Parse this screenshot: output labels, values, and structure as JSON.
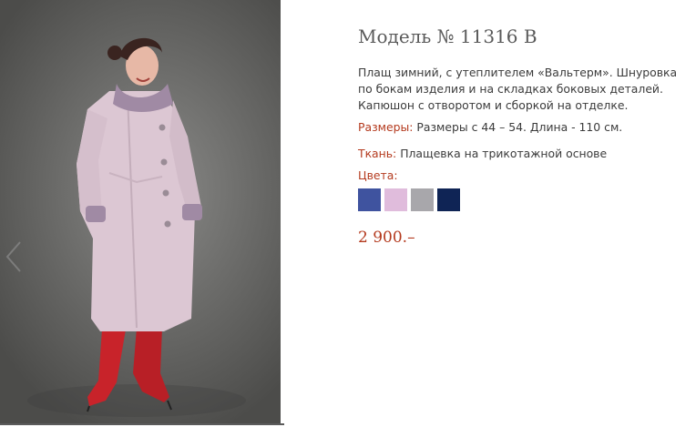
{
  "product": {
    "title": "Модель № 11316 В",
    "description": "Плащ зимний, с утеплителем «Вальтерм». Шнуровка по бокам изделия и на складках боковых деталей. Капюшон с отворотом и сборкой на отделке.",
    "sizes_label": "Размеры:",
    "sizes_value": "Размеры с 44 – 54. Длина - 110 см.",
    "fabric_label": "Ткань:",
    "fabric_value": "Плащевка на трикотажной основе",
    "colors_label": "Цвета:",
    "colors": [
      {
        "name": "blue",
        "hex": "#3f539f"
      },
      {
        "name": "pink",
        "hex": "#e0bcdc"
      },
      {
        "name": "grey",
        "hex": "#a8a7ab"
      },
      {
        "name": "navy",
        "hex": "#0f2455"
      }
    ],
    "price": "2 900.–"
  },
  "photo": {
    "alt_subject": "woman-in-lilac-coat",
    "coat_color": "#dcc7d3",
    "boots_color": "#c8232a",
    "collar_color": "#a08aa4"
  }
}
